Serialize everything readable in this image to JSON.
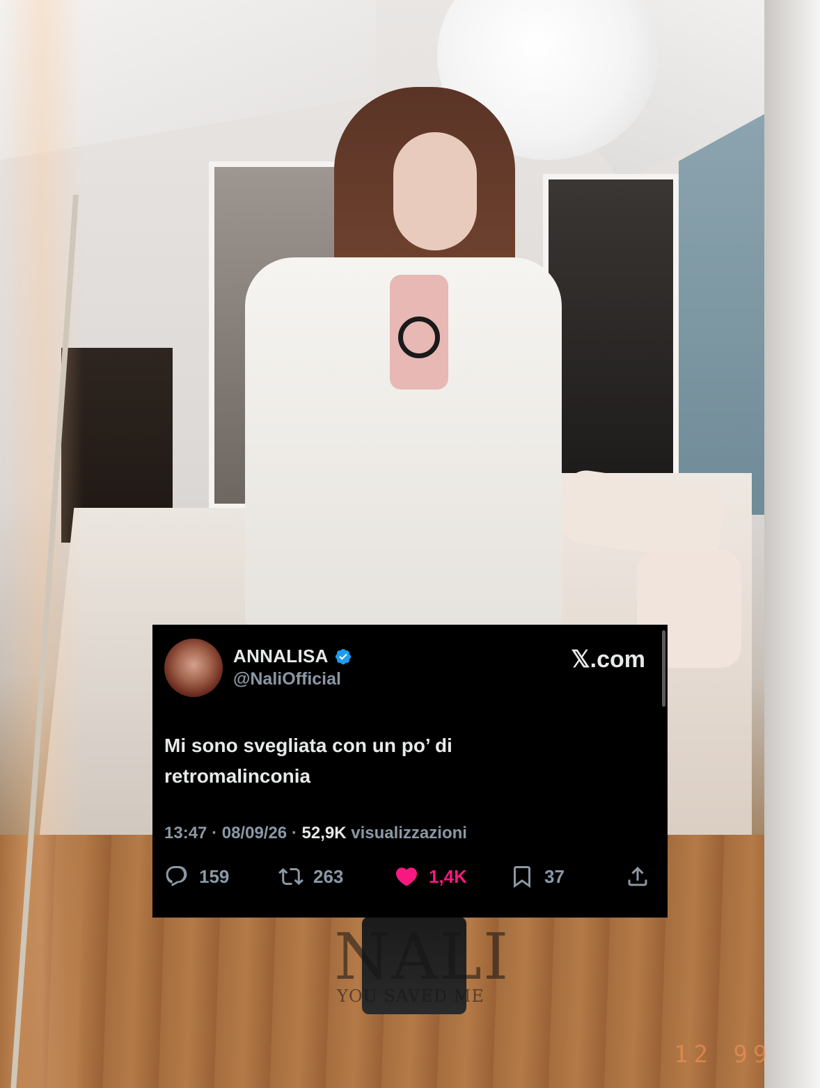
{
  "tweet": {
    "name": "ANNALISA",
    "handle": "@NaliOfficial",
    "site": "𝕏.com",
    "text_line1": "Mi sono svegliata con un po’ di",
    "text_line2": "retromalinconia",
    "time": "13:47",
    "date": "08/09/26",
    "views_count": "52,9K",
    "views_label": "visualizzazioni",
    "separator": "·",
    "replies": "159",
    "retweets": "263",
    "likes": "1,4K",
    "bookmarks": "37",
    "liked": true
  },
  "watermark": {
    "title": "NALI",
    "subtitle": "YOU SAVED ME"
  },
  "date_stamp": "12 99",
  "colors": {
    "card_bg": "#000000",
    "text_primary": "#e7e9ea",
    "text_secondary": "#8b98a5",
    "like_pink": "#f91880",
    "verified_blue": "#1d9bf0"
  },
  "icons": [
    "verified-badge-icon",
    "reply-icon",
    "retweet-icon",
    "heart-icon",
    "bookmark-icon",
    "share-icon"
  ]
}
